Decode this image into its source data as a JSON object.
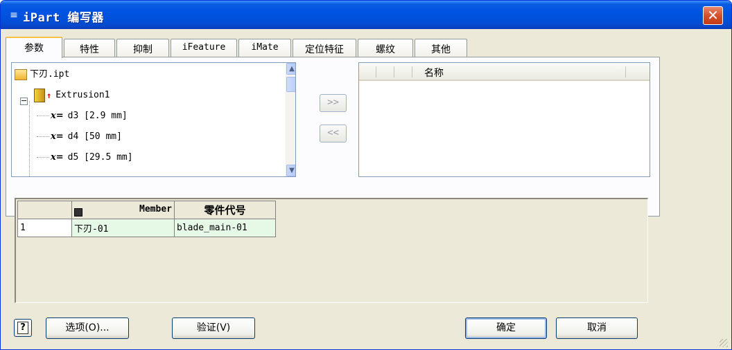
{
  "window": {
    "title": "iPart 编写器",
    "title_icon": "≡",
    "close_glyph": "✕"
  },
  "tabs": [
    {
      "label": "参数",
      "active": true
    },
    {
      "label": "特性"
    },
    {
      "label": "抑制"
    },
    {
      "label": "iFeature"
    },
    {
      "label": "iMate"
    },
    {
      "label": "定位特征"
    },
    {
      "label": "螺纹"
    },
    {
      "label": "其他"
    }
  ],
  "tree": {
    "root": "下刃.ipt",
    "feature": "Extrusion1",
    "params": [
      "d3 [2.9 mm]",
      "d4 [50 mm]",
      "d5 [29.5 mm]"
    ],
    "x_label": "x=",
    "expander": "−"
  },
  "move_buttons": {
    "add": ">>",
    "remove": "<<"
  },
  "selected_list": {
    "header_name": "名称"
  },
  "grid": {
    "columns": [
      "Member",
      "零件代号"
    ],
    "rows": [
      {
        "index": "1",
        "member": "下刃-01",
        "part_no": "blade_main-01"
      }
    ]
  },
  "buttons": {
    "help": "?",
    "options": "选项(O)...",
    "verify": "验证(V)",
    "ok": "确定",
    "cancel": "取消"
  },
  "colors": {
    "titlebar": "#0054e3",
    "client_bg": "#ece9d8",
    "grid_cell": "#e6f8e6",
    "close_btn": "#d8502b"
  }
}
